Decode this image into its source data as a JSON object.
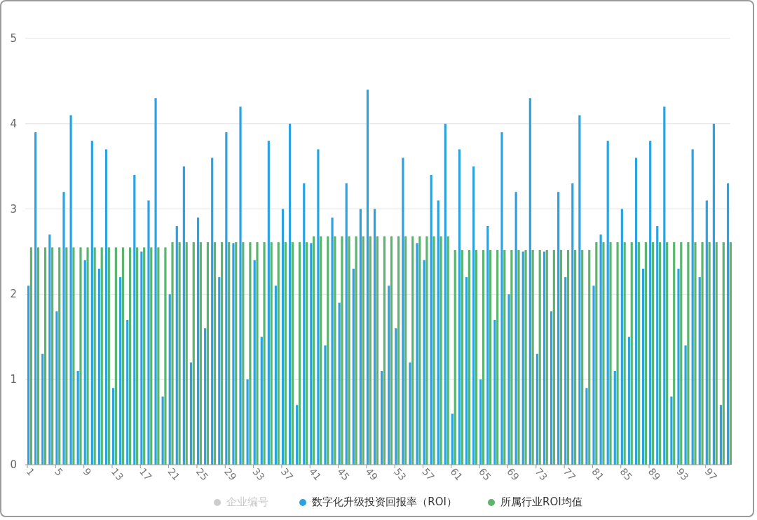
{
  "chart_data": {
    "type": "bar",
    "grid": true,
    "x": [
      1,
      2,
      3,
      4,
      5,
      6,
      7,
      8,
      9,
      10,
      11,
      12,
      13,
      14,
      15,
      16,
      17,
      18,
      19,
      20,
      21,
      22,
      23,
      24,
      25,
      26,
      27,
      28,
      29,
      30,
      31,
      32,
      33,
      34,
      35,
      36,
      37,
      38,
      39,
      40,
      41,
      42,
      43,
      44,
      45,
      46,
      47,
      48,
      49,
      50,
      51,
      52,
      53,
      54,
      55,
      56,
      57,
      58,
      59,
      60,
      61,
      62,
      63,
      64,
      65,
      66,
      67,
      68,
      69,
      70,
      71,
      72,
      73,
      74,
      75,
      76,
      77,
      78,
      79,
      80,
      81,
      82,
      83,
      84,
      85,
      86,
      87,
      88,
      89,
      90,
      91,
      92,
      93,
      94,
      95,
      96,
      97,
      98,
      99,
      100
    ],
    "series": [
      {
        "name": "数字化升级投资回报率（ROI）",
        "color": "#2ba3e3",
        "values": [
          2.1,
          3.9,
          1.3,
          2.7,
          1.8,
          3.2,
          4.1,
          1.1,
          2.4,
          3.8,
          2.3,
          3.7,
          0.9,
          2.2,
          1.7,
          3.4,
          2.5,
          3.1,
          4.3,
          0.8,
          2.0,
          2.8,
          3.5,
          1.2,
          2.9,
          1.6,
          3.6,
          2.2,
          3.9,
          2.6,
          4.2,
          1.0,
          2.4,
          1.5,
          3.8,
          2.1,
          3.0,
          4.0,
          0.7,
          3.3,
          2.6,
          3.7,
          1.4,
          2.9,
          1.9,
          3.3,
          2.3,
          3.0,
          4.4,
          3.0,
          1.1,
          2.1,
          1.6,
          3.6,
          1.2,
          2.6,
          2.4,
          3.4,
          3.1,
          4.0,
          0.6,
          3.7,
          2.2,
          3.5,
          1.0,
          2.8,
          1.7,
          3.9,
          2.0,
          3.2,
          2.5,
          4.3,
          1.3,
          2.5,
          1.8,
          3.2,
          2.2,
          3.3,
          4.1,
          0.9,
          2.1,
          2.7,
          3.8,
          1.1,
          3.0,
          1.5,
          3.6,
          2.3,
          3.8,
          2.8,
          4.2,
          0.8,
          2.3,
          1.4,
          3.7,
          2.2,
          3.1,
          4.0,
          0.7,
          3.3
        ]
      },
      {
        "name": "所属行业ROI均值",
        "color": "#5bb56c",
        "values": [
          2.55,
          2.55,
          2.55,
          2.55,
          2.55,
          2.55,
          2.55,
          2.55,
          2.55,
          2.55,
          2.55,
          2.55,
          2.55,
          2.55,
          2.55,
          2.55,
          2.55,
          2.55,
          2.55,
          2.55,
          2.61,
          2.61,
          2.61,
          2.61,
          2.61,
          2.61,
          2.61,
          2.61,
          2.61,
          2.61,
          2.61,
          2.61,
          2.61,
          2.61,
          2.61,
          2.61,
          2.61,
          2.61,
          2.61,
          2.61,
          2.68,
          2.68,
          2.68,
          2.68,
          2.68,
          2.68,
          2.68,
          2.68,
          2.68,
          2.68,
          2.68,
          2.68,
          2.68,
          2.68,
          2.68,
          2.68,
          2.68,
          2.68,
          2.68,
          2.68,
          2.52,
          2.52,
          2.52,
          2.52,
          2.52,
          2.52,
          2.52,
          2.52,
          2.52,
          2.52,
          2.52,
          2.52,
          2.52,
          2.52,
          2.52,
          2.52,
          2.52,
          2.52,
          2.52,
          2.52,
          2.61,
          2.61,
          2.61,
          2.61,
          2.61,
          2.61,
          2.61,
          2.61,
          2.61,
          2.61,
          2.61,
          2.61,
          2.61,
          2.61,
          2.61,
          2.61,
          2.61,
          2.61,
          2.61,
          2.61
        ]
      }
    ],
    "xlim": [
      0.7,
      100.5
    ],
    "ylim": [
      0,
      5
    ],
    "yticks": [
      0,
      1,
      2,
      3,
      4,
      5
    ],
    "xticks": [
      1,
      5,
      9,
      13,
      17,
      21,
      25,
      29,
      33,
      37,
      41,
      45,
      49,
      53,
      57,
      61,
      65,
      69,
      73,
      77,
      81,
      85,
      89,
      93,
      97
    ]
  },
  "legend": [
    {
      "label": "企业编号",
      "selected": false
    },
    {
      "selected": true
    },
    {
      "selected": true
    }
  ]
}
